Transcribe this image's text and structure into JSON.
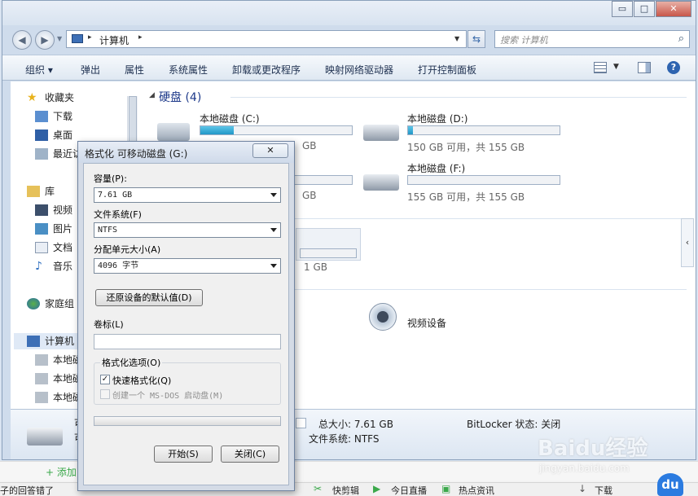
{
  "window": {
    "address_sep": "▸",
    "address_path": "计算机",
    "address_trailing": "▸",
    "search_placeholder": "搜索 计算机",
    "caption_minimize": "▭",
    "caption_maximize": "□",
    "caption_close": "✕"
  },
  "toolbar": {
    "organize": "组织 ▾",
    "eject": "弹出",
    "properties": "属性",
    "system_properties": "系统属性",
    "uninstall": "卸载或更改程序",
    "map_drive": "映射网络驱动器",
    "control_panel": "打开控制面板"
  },
  "nav": {
    "favorites": "收藏夹",
    "downloads": "下载",
    "desktop": "桌面",
    "recent": "最近访",
    "libraries": "库",
    "videos": "视频",
    "pictures": "图片",
    "documents": "文档",
    "music": "音乐",
    "homegroup": "家庭组",
    "computer": "计算机",
    "local1": "本地磁",
    "local2": "本地磁",
    "local3": "本地磁"
  },
  "content": {
    "section_header": "硬盘 (4)",
    "drive_c": {
      "name": "本地磁盘 (C:)",
      "free_partial": "GB",
      "fill": 0.22
    },
    "drive_d": {
      "name": "本地磁盘 (D:)",
      "free": "150 GB 可用，共 155 GB",
      "fill": 0.03
    },
    "drive_e": {
      "free_partial": "GB"
    },
    "drive_f": {
      "name": "本地磁盘 (F:)",
      "free": "155 GB 可用，共 155 GB",
      "fill": 0.0
    },
    "removable_partial": "1 GB",
    "video_device": "视频设备"
  },
  "details": {
    "total_size": "总大小: 7.61 GB",
    "filesystem": "文件系统: NTFS",
    "bitlocker": "BitLocker 状态: 关闭",
    "name_partial1": "可",
    "name_partial2": "可"
  },
  "dialog": {
    "title": "格式化 可移动磁盘 (G:)",
    "close": "✕",
    "capacity_label": "容量(P):",
    "capacity_value": "7.61 GB",
    "filesystem_label": "文件系统(F)",
    "filesystem_value": "NTFS",
    "alloc_label": "分配单元大小(A)",
    "alloc_value": "4096 字节",
    "restore_button": "还原设备的默认值(D)",
    "volume_label": "卷标(L)",
    "volume_value": "",
    "options_label": "格式化选项(O)",
    "quick_format": "快速格式化(Q)",
    "quick_format_checked": "✓",
    "msdos_boot": "创建一个 MS-DOS 启动盘(M)",
    "start_button": "开始(S)",
    "close_button": "关闭(C)"
  },
  "taskbar": {
    "left_text": "子的回答错了",
    "add_text": "+ 添加",
    "kuaiji": "快剪辑",
    "live": "今日直播",
    "hot": "热点资讯",
    "download": "下载"
  },
  "watermark": {
    "brand": "Baidu经验",
    "url": "jingyan.baidu.com",
    "du": "du"
  },
  "colors": {
    "accent": "#2197c7",
    "window_chrome": "#cfdcec"
  }
}
